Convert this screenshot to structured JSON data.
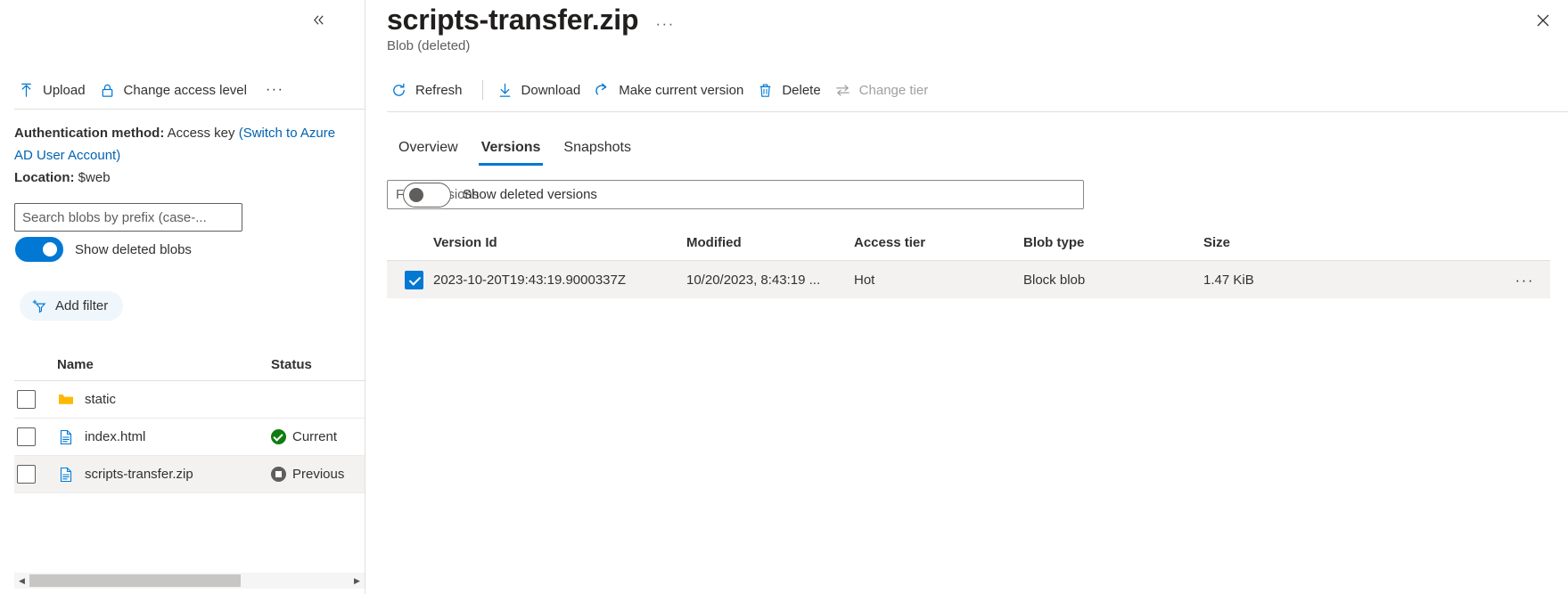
{
  "left_panel": {
    "collapse_icon": "chevron-double-left-icon",
    "commands": [
      {
        "label": "Upload",
        "icon": "upload-icon",
        "disabled": false
      },
      {
        "label": "Change access level",
        "icon": "lock-icon",
        "disabled": false
      }
    ],
    "overflow_label": "···",
    "auth": {
      "method_label": "Authentication method:",
      "method_value": "Access key",
      "switch_link": "(Switch to Azure AD User Account)",
      "location_label": "Location:",
      "location_value": "$web"
    },
    "search": {
      "placeholder": "Search blobs by prefix (case-...",
      "value": ""
    },
    "show_deleted_blobs": {
      "label": "Show deleted blobs",
      "state": "on"
    },
    "add_filter": {
      "label": "Add filter",
      "icon": "add-filter-icon"
    },
    "table": {
      "columns": [
        "Name",
        "Status"
      ],
      "rows": [
        {
          "name": "static",
          "icon": "folder-icon",
          "status": "",
          "status_icon": "",
          "checked": false,
          "selected": false
        },
        {
          "name": "index.html",
          "icon": "file-icon",
          "status": "Current",
          "status_icon": "check-circle-icon",
          "checked": false,
          "selected": false
        },
        {
          "name": "scripts-transfer.zip",
          "icon": "file-icon",
          "status": "Previous",
          "status_icon": "previous-version-icon",
          "checked": false,
          "selected": true
        }
      ]
    },
    "hscrollbar": {
      "left_arrow": "◀",
      "right_arrow": "▶"
    }
  },
  "right_panel": {
    "title": "scripts-transfer.zip",
    "title_overflow": "···",
    "subtitle": "Blob (deleted)",
    "close_icon": "close-icon",
    "commands": [
      {
        "label": "Refresh",
        "icon": "refresh-icon",
        "disabled": false,
        "divider_after": true
      },
      {
        "label": "Download",
        "icon": "download-icon",
        "disabled": false,
        "divider_after": false
      },
      {
        "label": "Make current version",
        "icon": "restore-icon",
        "disabled": false,
        "divider_after": false
      },
      {
        "label": "Delete",
        "icon": "trash-icon",
        "disabled": false,
        "divider_after": false
      },
      {
        "label": "Change tier",
        "icon": "swap-icon",
        "disabled": true,
        "divider_after": false
      }
    ],
    "tabs": [
      {
        "label": "Overview",
        "active": false
      },
      {
        "label": "Versions",
        "active": true
      },
      {
        "label": "Snapshots",
        "active": false
      }
    ],
    "filter": {
      "placeholder": "Filter versions",
      "value": ""
    },
    "show_deleted_versions": {
      "label": "Show deleted versions",
      "state": "off"
    },
    "versions_table": {
      "columns": [
        "Version Id",
        "Modified",
        "Access tier",
        "Blob type",
        "Size"
      ],
      "rows": [
        {
          "checked": true,
          "version_id": "2023-10-20T19:43:19.9000337Z",
          "modified": "10/20/2023, 8:43:19 ...",
          "access_tier": "Hot",
          "blob_type": "Block blob",
          "size": "1.47 KiB",
          "row_menu": "···"
        }
      ]
    }
  },
  "colors": {
    "accent": "#0078d4",
    "link": "#0063b1",
    "text": "#323130",
    "muted": "#605e5c",
    "disabled": "#a19f9d",
    "row_selected": "#f3f2f1",
    "folder": "#ffb900",
    "success": "#107c10"
  }
}
